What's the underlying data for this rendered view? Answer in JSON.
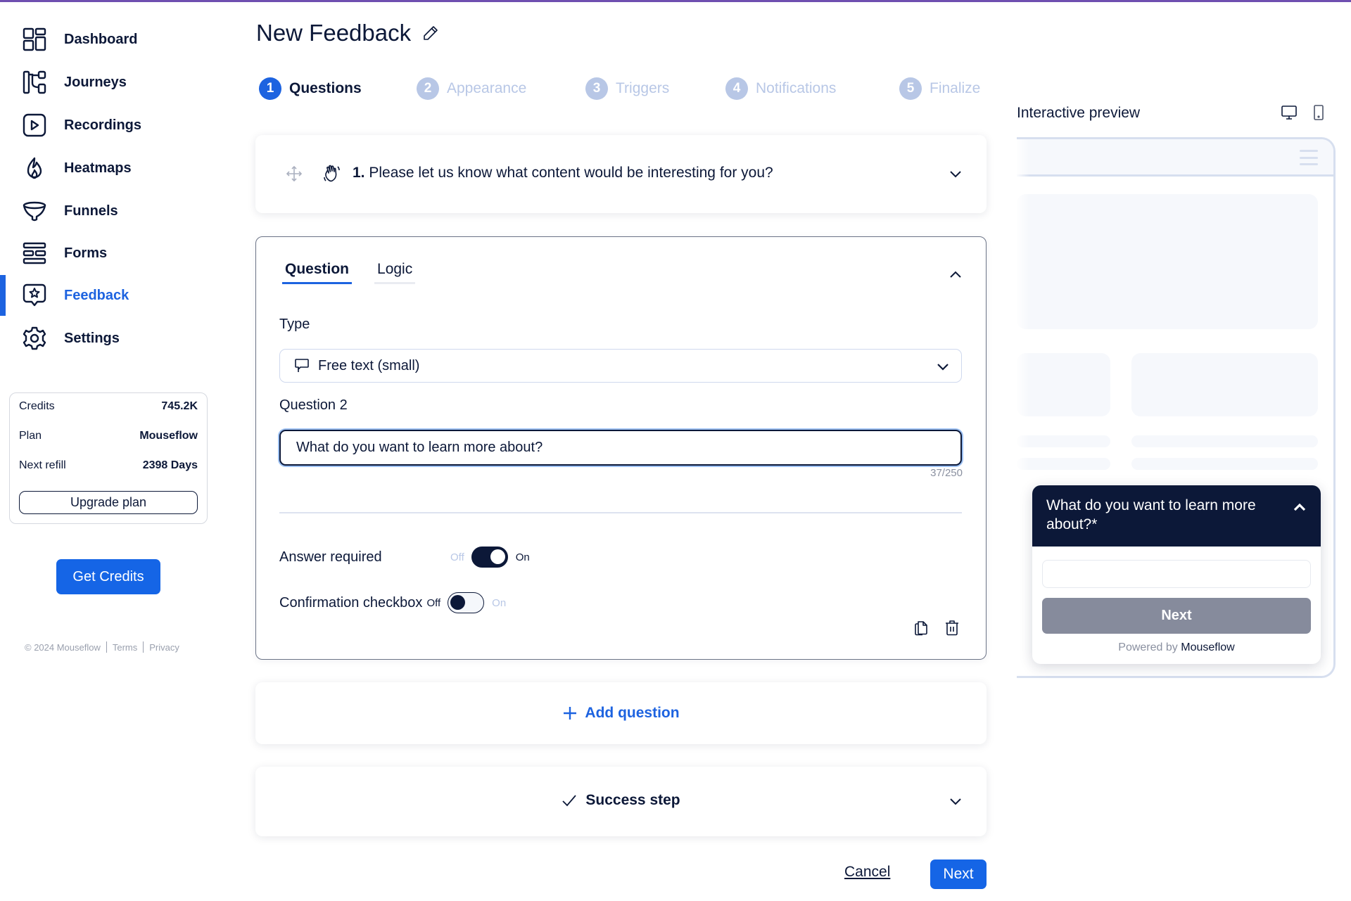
{
  "sidebar": {
    "items": [
      {
        "label": "Dashboard",
        "icon": "dashboard-icon"
      },
      {
        "label": "Journeys",
        "icon": "journeys-icon"
      },
      {
        "label": "Recordings",
        "icon": "recordings-icon"
      },
      {
        "label": "Heatmaps",
        "icon": "heatmaps-icon"
      },
      {
        "label": "Funnels",
        "icon": "funnels-icon"
      },
      {
        "label": "Forms",
        "icon": "forms-icon"
      },
      {
        "label": "Feedback",
        "icon": "feedback-icon",
        "active": true
      },
      {
        "label": "Settings",
        "icon": "settings-icon"
      }
    ],
    "credits": {
      "credits_label": "Credits",
      "credits_value": "745.2K",
      "plan_label": "Plan",
      "plan_value": "Mouseflow",
      "refill_label": "Next refill",
      "refill_value": "2398 Days",
      "upgrade_label": "Upgrade plan"
    },
    "get_credits_label": "Get Credits",
    "footer": {
      "copyright": "© 2024 Mouseflow",
      "terms": "Terms",
      "privacy": "Privacy"
    }
  },
  "header": {
    "title": "New Feedback"
  },
  "steps": [
    {
      "num": "1",
      "label": "Questions",
      "active": true
    },
    {
      "num": "2",
      "label": "Appearance"
    },
    {
      "num": "3",
      "label": "Triggers"
    },
    {
      "num": "4",
      "label": "Notifications"
    },
    {
      "num": "5",
      "label": "Finalize"
    }
  ],
  "question1": {
    "number": "1.",
    "text": "Please let us know what content would be interesting for you?"
  },
  "editor": {
    "tabs": [
      {
        "label": "Question",
        "active": true
      },
      {
        "label": "Logic"
      }
    ],
    "type_label": "Type",
    "type_value": "Free text (small)",
    "question_label": "Question 2",
    "question_value": "What do you want to learn more about?",
    "counter": "37/250",
    "answer_required": {
      "label": "Answer required",
      "off": "Off",
      "on": "On",
      "value": true
    },
    "confirmation_checkbox": {
      "label": "Confirmation checkbox",
      "off": "Off",
      "on": "On",
      "value": false
    }
  },
  "add_question_label": "Add question",
  "success_step_label": "Success step",
  "actions": {
    "cancel": "Cancel",
    "next": "Next"
  },
  "preview": {
    "title": "Interactive preview",
    "widget": {
      "question": "What do you want to learn more about?*",
      "next": "Next",
      "powered_by": "Powered by",
      "brand": "Mouseflow"
    }
  },
  "colors": {
    "accent": "#1d63e0",
    "button": "#1565e6",
    "navy": "#0c1838",
    "muted_step": "#b8c7e6",
    "topbar": "#6f4fb0"
  }
}
